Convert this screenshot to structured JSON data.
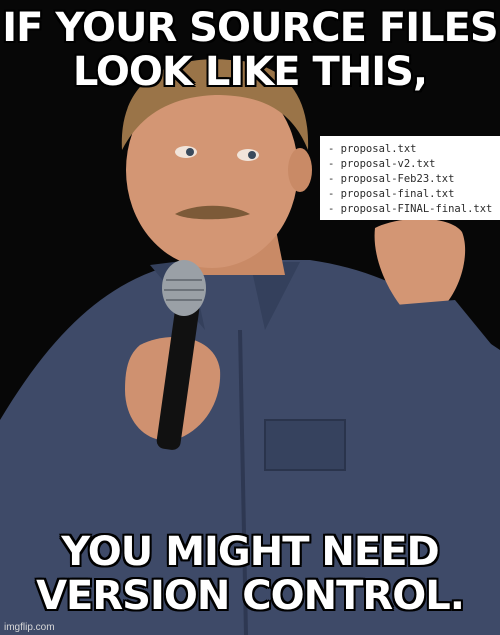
{
  "caption_top": "IF YOUR SOURCE FILES LOOK LIKE THIS,",
  "caption_bottom": "YOU MIGHT NEED VERSION CONTROL.",
  "file_list": [
    "- proposal.txt",
    "- proposal-v2.txt",
    "- proposal-Feb23.txt",
    "- proposal-final.txt",
    "- proposal-FINAL-final.txt"
  ],
  "watermark": "imgflip.com"
}
